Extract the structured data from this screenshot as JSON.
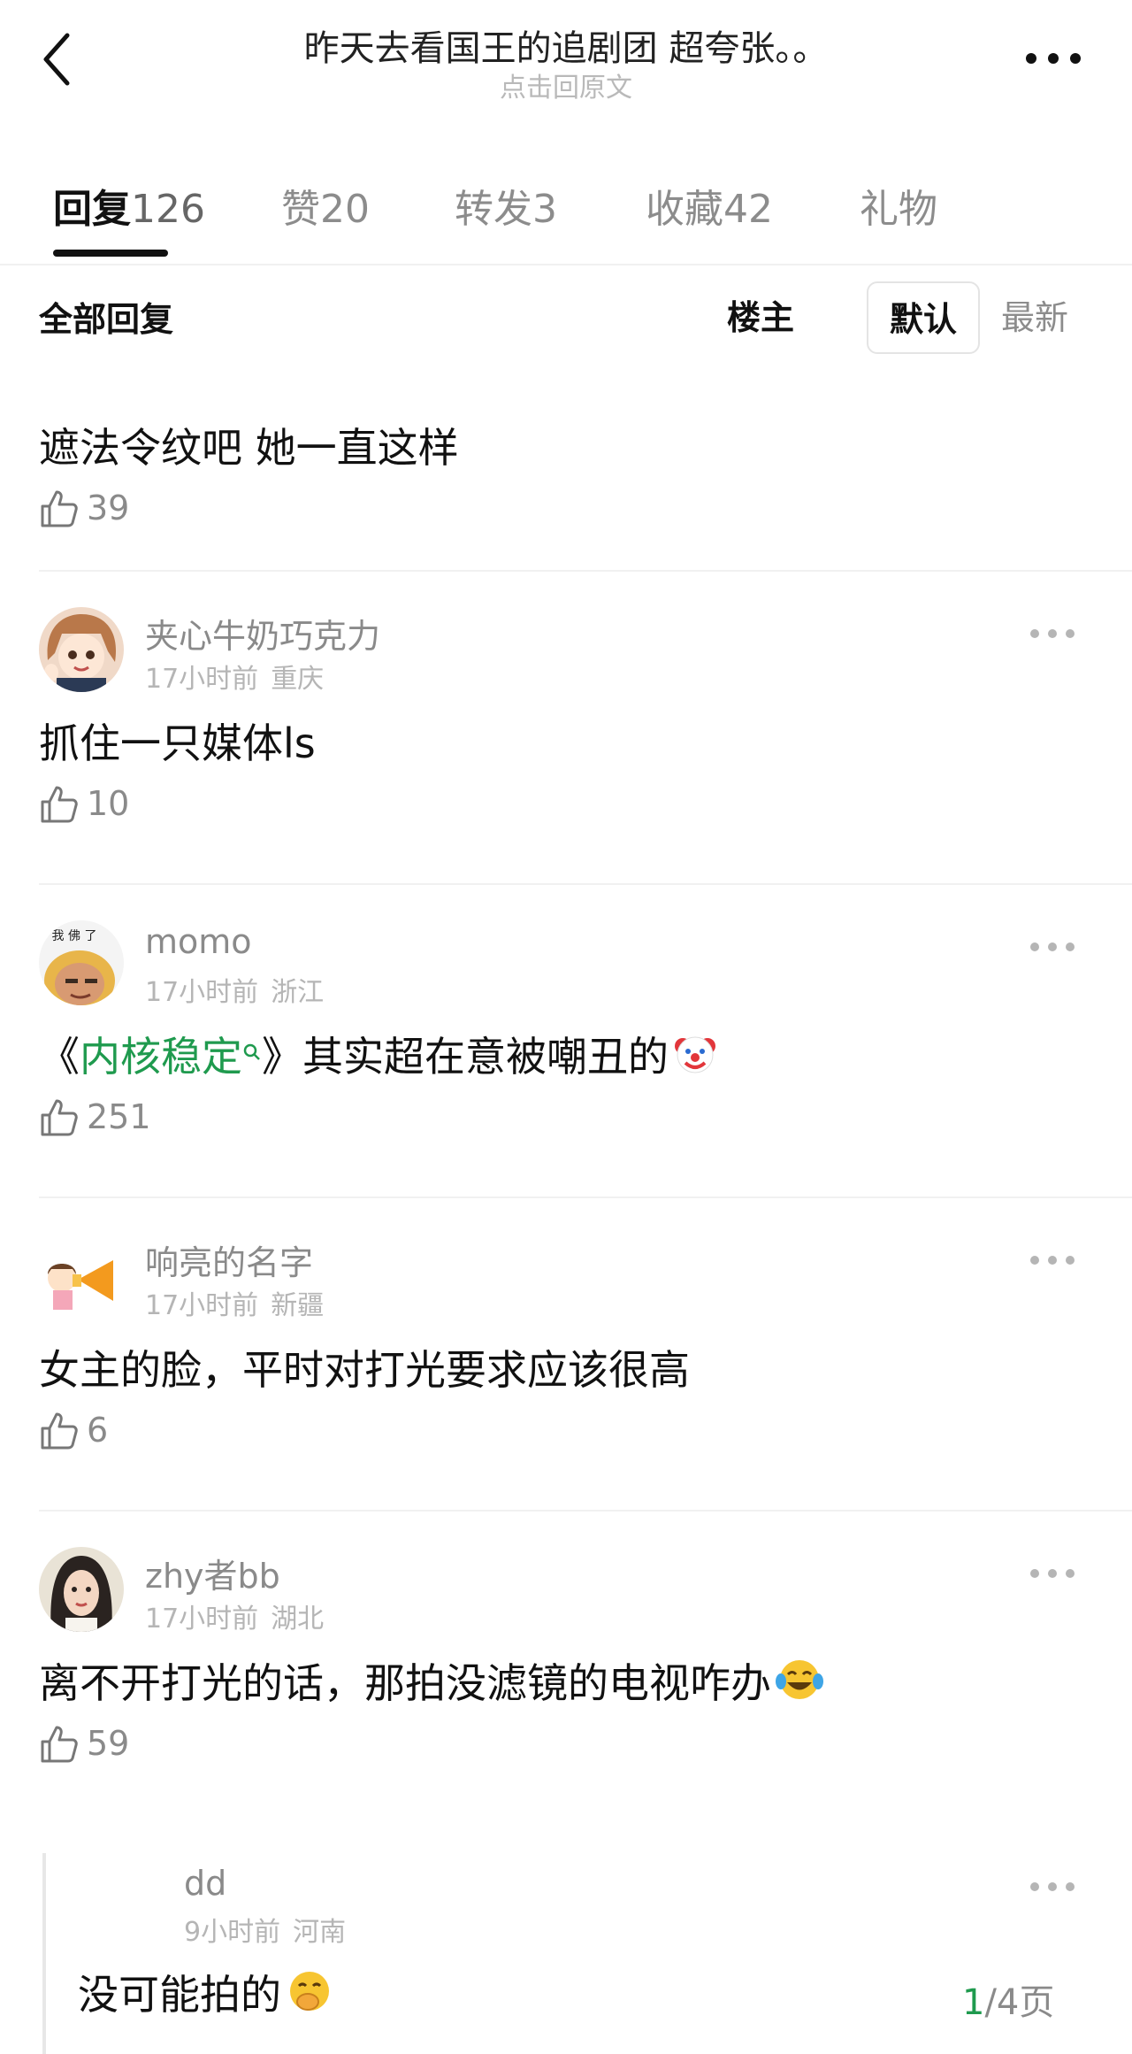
{
  "header": {
    "title": "昨天去看国王的追剧团 超夸张。。",
    "subtitle": "点击回原文"
  },
  "tabs": [
    {
      "label": "回复",
      "count": "126"
    },
    {
      "label": "赞",
      "count": "20"
    },
    {
      "label": "转发",
      "count": "3"
    },
    {
      "label": "收藏",
      "count": "42"
    },
    {
      "label": "礼物",
      "count": ""
    }
  ],
  "filter": {
    "title": "全部回复",
    "owner": "楼主",
    "default": "默认",
    "latest": "最新"
  },
  "comments": [
    {
      "text": "遮法令纹吧 她一直这样",
      "likes": "39"
    },
    {
      "name": "夹心牛奶巧克力",
      "time": "17小时前",
      "location": "重庆",
      "text": "抓住一只媒体ls",
      "likes": "10"
    },
    {
      "name": "momo",
      "time": "17小时前",
      "location": "浙江",
      "text_before": "《",
      "topic": "内核稳定",
      "text_after": "》其实超在意被嘲丑的",
      "emoji": "clown-face",
      "likes": "251",
      "avatar_caption": "我 佛 了"
    },
    {
      "name": "响亮的名字",
      "time": "17小时前",
      "location": "新疆",
      "text": "女主的脸，平时对打光要求应该很高",
      "likes": "6"
    },
    {
      "name": "zhy者bb",
      "time": "17小时前",
      "location": "湖北",
      "text": "离不开打光的话，那拍没滤镜的电视咋办",
      "emoji": "tears-of-joy-face",
      "likes": "59"
    }
  ],
  "reply": {
    "name": "dd",
    "time": "9小时前",
    "location": "河南",
    "text": "没可能拍的",
    "emoji": "hand-over-mouth-face"
  },
  "pager": {
    "current": "1",
    "total": "/4",
    "unit": "页"
  }
}
